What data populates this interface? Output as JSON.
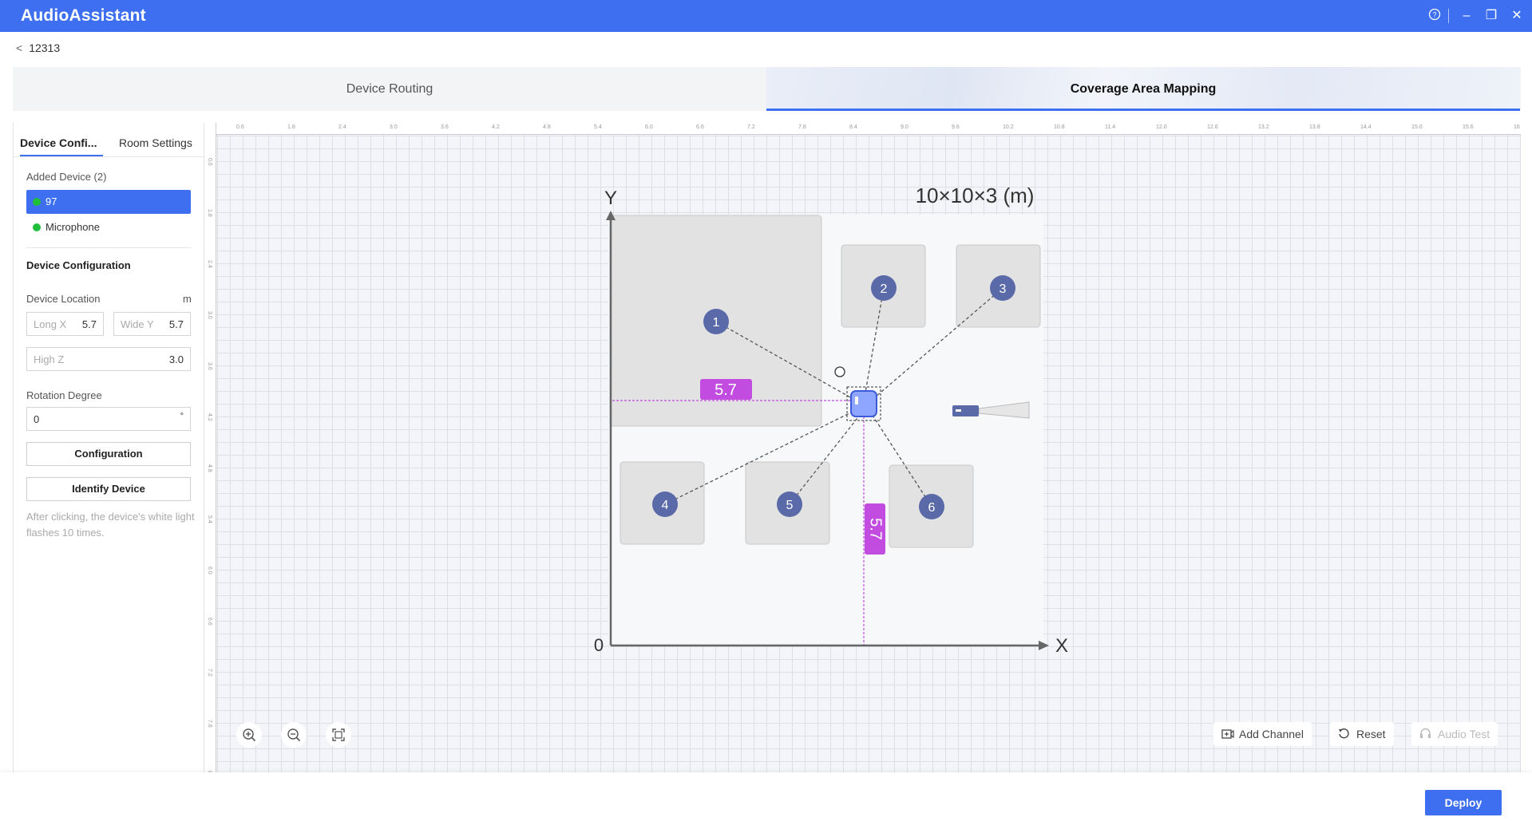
{
  "app": {
    "title": "AudioAssistant"
  },
  "window_controls": {
    "help": "?",
    "minimize": "–",
    "restore": "❐",
    "close": "✕"
  },
  "breadcrumb": {
    "back": "<",
    "label": "12313"
  },
  "main_tabs": [
    {
      "label": "Device Routing"
    },
    {
      "label": "Coverage Area Mapping"
    }
  ],
  "left_panel": {
    "tabs": [
      {
        "label": "Device Confi..."
      },
      {
        "label": "Room Settings"
      }
    ],
    "added_devices_label": "Added Device (2)",
    "devices": [
      {
        "name": "97",
        "status_color": "#1fbf3a"
      },
      {
        "name": "Microphone",
        "status_color": "#1fbf3a"
      }
    ],
    "config_title": "Device Configuration",
    "location_label": "Device Location",
    "location_unit": "m",
    "long_x": {
      "placeholder": "Long X",
      "value": "5.7"
    },
    "wide_y": {
      "placeholder": "Wide Y",
      "value": "5.7"
    },
    "high_z": {
      "placeholder": "High Z",
      "value": "3.0"
    },
    "rotation_label": "Rotation Degree",
    "rotation": {
      "value": "0",
      "unit": "°"
    },
    "configuration_button": "Configuration",
    "identify_button": "Identify Device",
    "identify_note": "After clicking, the device's white light flashes 10 times."
  },
  "ruler": {
    "top": [
      "0.6",
      "1.8",
      "2.4",
      "3.0",
      "3.6",
      "4.2",
      "4.8",
      "5.4",
      "6.0",
      "6.6",
      "7.2",
      "7.8",
      "8.4",
      "9.0",
      "9.6",
      "10.2",
      "10.8",
      "11.4",
      "12.0",
      "12.6",
      "13.2",
      "13.8",
      "14.4",
      "15.0",
      "15.6",
      "16"
    ],
    "left": [
      "0.6",
      "1.8",
      "2.4",
      "3.0",
      "3.6",
      "4.2",
      "4.8",
      "5.4",
      "6.0",
      "6.6",
      "7.2",
      "7.8",
      "8.4"
    ]
  },
  "room": {
    "dimensions": "10×10×3 (m)",
    "axis_x": "X",
    "axis_y": "Y",
    "origin": "0",
    "device_x_label": "5.7",
    "device_y_label": "5.7",
    "zones": [
      "1",
      "2",
      "3",
      "4",
      "5",
      "6"
    ]
  },
  "canvas_tools": {
    "zoom_in": "⊕",
    "zoom_out": "⊖",
    "fit": "⛶"
  },
  "actions": {
    "add_channel": "Add Channel",
    "reset": "Reset",
    "audio_test": "Audio Test"
  },
  "footer": {
    "deploy": "Deploy"
  },
  "colors": {
    "brand": "#3d6ff0",
    "zone_marker": "#5a6aa8",
    "measure": "#c24be0",
    "status_online": "#1fbf3a"
  }
}
